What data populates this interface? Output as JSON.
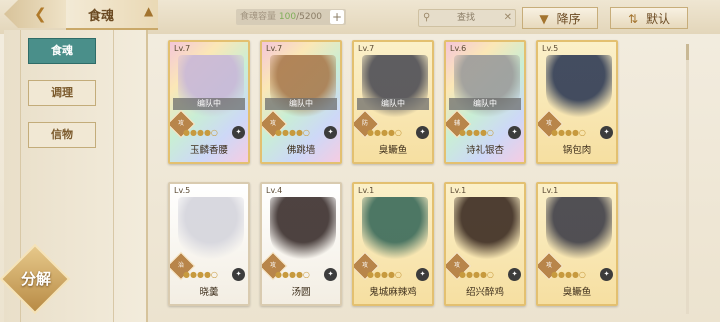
{
  "header": {
    "title": "食魂",
    "capacity_label": "食魂容量",
    "capacity_current": "100",
    "capacity_max": "/5200",
    "search_placeholder": "查找",
    "sort_label": "降序",
    "filter_label": "默认"
  },
  "sidebar": {
    "tabs": [
      {
        "label": "食魂",
        "active": true
      },
      {
        "label": "调理",
        "active": false
      },
      {
        "label": "信物",
        "active": false
      }
    ],
    "decompose_label": "分解"
  },
  "cards": [
    {
      "level": "Lv.7",
      "name": "玉麟香腰",
      "status": "编队中",
      "role": "攻",
      "style": "holo",
      "hue": "#c8b7d8",
      "stars": "●●●●○"
    },
    {
      "level": "Lv.7",
      "name": "佛跳墙",
      "status": "编队中",
      "role": "攻",
      "style": "holo",
      "hue": "#a97a4e",
      "stars": "●●●●○"
    },
    {
      "level": "Lv.7",
      "name": "臭鳜鱼",
      "status": "编队中",
      "role": "防",
      "style": "gold",
      "hue": "#4d4d55",
      "stars": "●●●●○"
    },
    {
      "level": "Lv.6",
      "name": "诗礼银杏",
      "status": "编队中",
      "role": "辅",
      "style": "holo",
      "hue": "#9b9b9b",
      "stars": "●●●●○"
    },
    {
      "level": "Lv.5",
      "name": "锅包肉",
      "status": "",
      "role": "攻",
      "style": "gold",
      "hue": "#2f3b55",
      "stars": "●●●●○"
    },
    {
      "level": "Lv.5",
      "name": "晓羹",
      "status": "",
      "role": "治",
      "style": "white",
      "hue": "#d4d4dc",
      "stars": "●●●●○"
    },
    {
      "level": "Lv.4",
      "name": "汤圆",
      "status": "",
      "role": "攻",
      "style": "white",
      "hue": "#3a2e2c",
      "stars": "●●●●○"
    },
    {
      "level": "Lv.1",
      "name": "鬼城麻辣鸡",
      "status": "",
      "role": "攻",
      "style": "gold",
      "hue": "#3a6a5a",
      "stars": "●●●●○"
    },
    {
      "level": "Lv.1",
      "name": "绍兴醉鸡",
      "status": "",
      "role": "攻",
      "style": "gold",
      "hue": "#3b2b22",
      "stars": "●●●●○"
    },
    {
      "level": "Lv.1",
      "name": "臭鳜鱼",
      "status": "",
      "role": "攻",
      "style": "gold",
      "hue": "#3e3e48",
      "stars": "●●●●○"
    }
  ]
}
